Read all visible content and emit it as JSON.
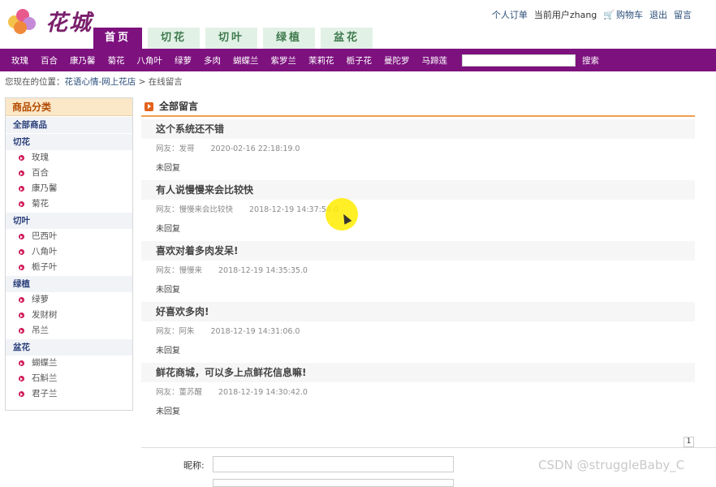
{
  "header": {
    "logo_text": "花城",
    "top_links": {
      "orders": "个人订单",
      "current_user": "当前用户zhang",
      "cart": "购物车",
      "logout": "退出",
      "message": "留言"
    },
    "tabs": [
      {
        "label": "首页",
        "active": true
      },
      {
        "label": "切花",
        "active": false
      },
      {
        "label": "切叶",
        "active": false
      },
      {
        "label": "绿植",
        "active": false
      },
      {
        "label": "盆花",
        "active": false
      }
    ]
  },
  "category_bar": {
    "items": [
      "玫瑰",
      "百合",
      "康乃馨",
      "菊花",
      "八角叶",
      "绿萝",
      "多肉",
      "蝴蝶兰",
      "紫罗兰",
      "茉莉花",
      "栀子花",
      "曼陀罗",
      "马蹄莲"
    ],
    "search_placeholder": "",
    "search_button": "搜索"
  },
  "breadcrumb": {
    "prefix": "您现在的位置：",
    "home_link": "花语心情-网上花店",
    "separator": ">",
    "current": "在线留言"
  },
  "sidebar": {
    "title": "商品分类",
    "all_label": "全部商品",
    "groups": [
      {
        "name": "切花",
        "items": [
          "玫瑰",
          "百合",
          "康乃馨",
          "菊花"
        ]
      },
      {
        "name": "切叶",
        "items": [
          "巴西叶",
          "八角叶",
          "栀子叶"
        ]
      },
      {
        "name": "绿植",
        "items": [
          "绿萝",
          "发财树",
          "吊兰"
        ]
      },
      {
        "name": "盆花",
        "items": [
          "蝴蝶兰",
          "石斛兰",
          "君子兰"
        ]
      }
    ]
  },
  "main": {
    "title": "全部留言",
    "messages": [
      {
        "title": "这个系统还不错",
        "author": "网友：发哥",
        "time": "2020-02-16 22:18:19.0",
        "reply": "未回复"
      },
      {
        "title": "有人说慢慢来会比较快",
        "author": "网友：慢慢来会比较快",
        "time": "2018-12-19 14:37:54.0",
        "reply": "未回复"
      },
      {
        "title": "喜欢对着多肉发呆!",
        "author": "网友：慢慢来",
        "time": "2018-12-19 14:35:35.0",
        "reply": "未回复"
      },
      {
        "title": "好喜欢多肉!",
        "author": "网友：阿朱",
        "time": "2018-12-19 14:31:06.0",
        "reply": "未回复"
      },
      {
        "title": "鲜花商城，可以多上点鲜花信息嘛!",
        "author": "网友：董苏醒",
        "time": "2018-12-19 14:30:42.0",
        "reply": "未回复"
      }
    ],
    "page_number": "1",
    "nickname_label": "昵称:",
    "nickname_value": ""
  },
  "watermark": "CSDN @struggleBaby_C",
  "colors": {
    "brand_purple": "#7d117e",
    "tab_green_bg": "#e2f1e6",
    "accent_orange": "#f0a050"
  }
}
